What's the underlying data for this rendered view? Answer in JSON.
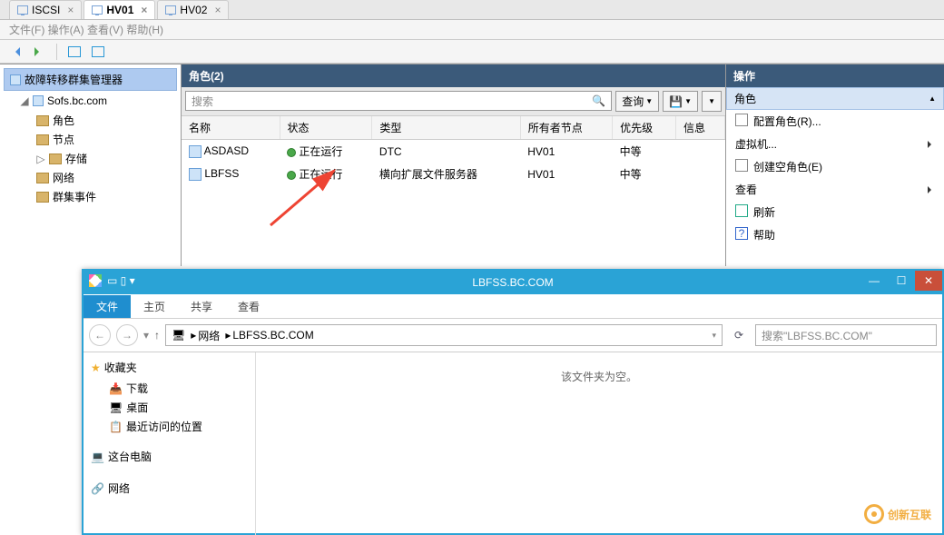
{
  "tabs": [
    {
      "label": "ISCSI",
      "active": false
    },
    {
      "label": "HV01",
      "active": true
    },
    {
      "label": "HV02",
      "active": false
    }
  ],
  "menubar": "文件(F)   操作(A)   查看(V)   帮助(H)",
  "tree": {
    "title": "故障转移群集管理器",
    "cluster": "Sofs.bc.com",
    "nodes": [
      "角色",
      "节点",
      "存储",
      "网络",
      "群集事件"
    ]
  },
  "center": {
    "title": "角色(2)",
    "search_placeholder": "搜索",
    "query_btn": "查询",
    "columns": [
      "名称",
      "状态",
      "类型",
      "所有者节点",
      "优先级",
      "信息"
    ],
    "rows": [
      {
        "name": "ASDASD",
        "status": "正在运行",
        "type": "DTC",
        "owner": "HV01",
        "priority": "中等"
      },
      {
        "name": "LBFSS",
        "status": "正在运行",
        "type": "横向扩展文件服务器",
        "owner": "HV01",
        "priority": "中等"
      }
    ]
  },
  "actions": {
    "title": "操作",
    "subtitle": "角色",
    "items": [
      {
        "label": "配置角色(R)...",
        "submenu": false
      },
      {
        "label": "虚拟机...",
        "submenu": true
      },
      {
        "label": "创建空角色(E)",
        "submenu": false
      },
      {
        "label": "查看",
        "submenu": true
      },
      {
        "label": "刷新",
        "submenu": false
      },
      {
        "label": "帮助",
        "submenu": false
      }
    ]
  },
  "explorer": {
    "title": "LBFSS.BC.COM",
    "ribbon": {
      "file": "文件",
      "tabs": [
        "主页",
        "共享",
        "查看"
      ]
    },
    "breadcrumb": [
      "网络",
      "LBFSS.BC.COM"
    ],
    "search_placeholder": "搜索\"LBFSS.BC.COM\"",
    "empty_text": "该文件夹为空。",
    "nav": {
      "favorites": "收藏夹",
      "fav_items": [
        "下载",
        "桌面",
        "最近访问的位置"
      ],
      "computer": "这台电脑",
      "network": "网络"
    }
  },
  "watermark": "创新互联"
}
